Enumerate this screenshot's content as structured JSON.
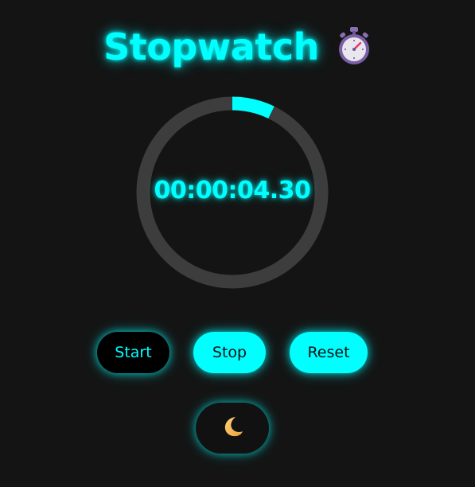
{
  "app": {
    "title": "Stopwatch",
    "title_icon": "stopwatch-icon"
  },
  "timer": {
    "display": "00:00:04.30",
    "progress_fraction": 0.072
  },
  "controls": {
    "start_label": "Start",
    "stop_label": "Stop",
    "reset_label": "Reset",
    "theme_toggle_icon": "moon-icon"
  },
  "colors": {
    "accent": "#00ffff",
    "background": "#141414",
    "ring_track": "#3d3d3d",
    "button_dark": "#000000"
  }
}
